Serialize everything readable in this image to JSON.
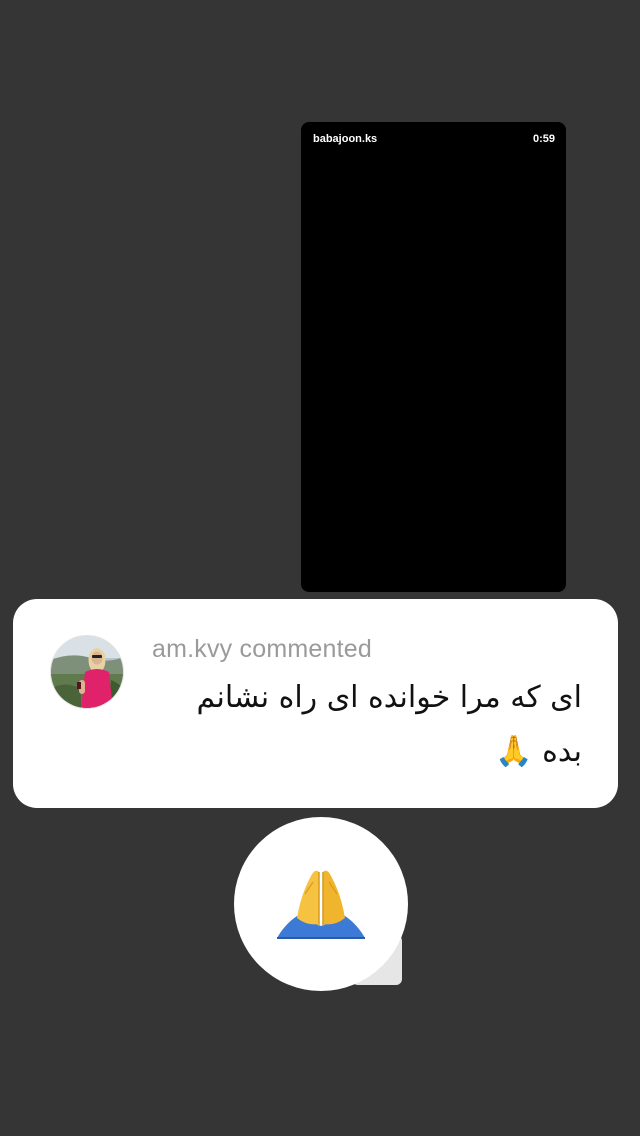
{
  "video": {
    "username": "babajoon.ks",
    "duration": "0:59"
  },
  "comment": {
    "header": "am.kvy commented",
    "text": "ای که مرا خوانده ای  راه نشانم بده 🙏",
    "avatar": "avatar-photo"
  },
  "reply": {
    "icon": "folded-hands-icon"
  },
  "colors": {
    "background": "#353535",
    "card": "#ffffff",
    "header_text": "#9a9a9a",
    "video": "#000000"
  }
}
